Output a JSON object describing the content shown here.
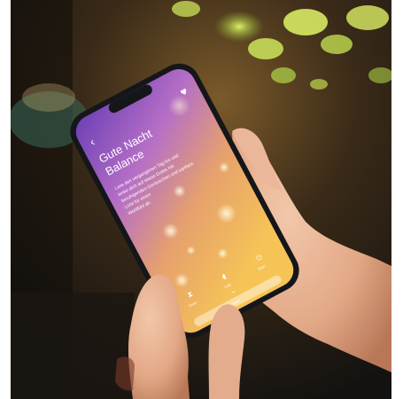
{
  "screen": {
    "back_glyph": "‹",
    "heart_glyph": "♥",
    "title_line1": "Gute Nacht",
    "title_line2": "Balance",
    "body_line1": "Lass den vergangenen Tag los und",
    "body_line2": "lenke dich auf etwas Gutes mit",
    "body_line3": "beruhigenden Geräuschen und sanftem",
    "body_line4": "Licht für einen",
    "body_line5": "Wohlfühl ab.",
    "controls": [
      {
        "icon": "timer-icon",
        "glyph": "⧗",
        "label": "Timer"
      },
      {
        "icon": "volume-icon",
        "glyph": "◖",
        "label": "Laut"
      },
      {
        "icon": "power-icon",
        "glyph": "⏻",
        "label": "Start"
      }
    ],
    "chevron_glyph": "⌄",
    "bottom_bar_label": "Weiter schlafen"
  },
  "colors": {
    "gradient_top": "#7a3fbf",
    "gradient_mid": "#c978c8",
    "gradient_bottom": "#f3b24a",
    "phone_frame": "#15161a",
    "skin": "#e7b59a",
    "background": "#2a1f14"
  }
}
